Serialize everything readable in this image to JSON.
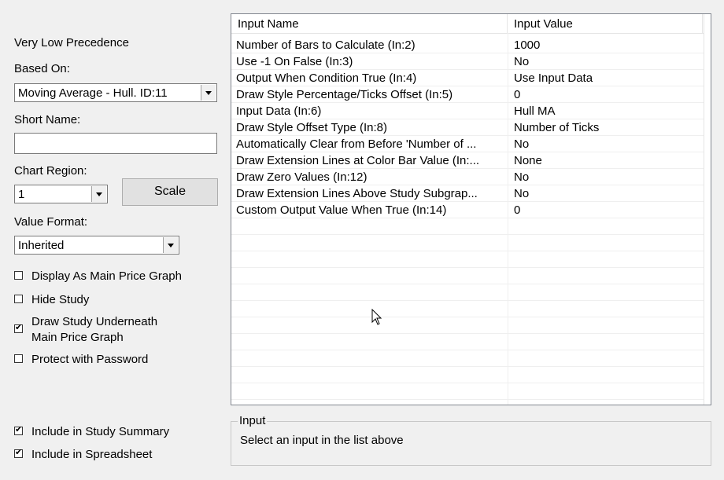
{
  "left": {
    "precedence_label": "Very Low Precedence",
    "based_on_label": "Based On:",
    "based_on_value": "Moving Average - Hull. ID:11",
    "short_name_label": "Short Name:",
    "short_name_value": "",
    "chart_region_label": "Chart Region:",
    "chart_region_value": "1",
    "scale_button": "Scale",
    "value_format_label": "Value Format:",
    "value_format_value": "Inherited",
    "checkboxes": [
      {
        "label": "Display As Main Price Graph",
        "checked": false
      },
      {
        "label": "Hide Study",
        "checked": false
      },
      {
        "label": "Draw Study Underneath",
        "label2": "Main Price Graph",
        "checked": true
      },
      {
        "label": "Protect with Password",
        "checked": false
      },
      {
        "label": "Include in Study Summary",
        "checked": true
      },
      {
        "label": "Include in Spreadsheet",
        "checked": true
      }
    ]
  },
  "grid": {
    "headers": [
      "Input Name",
      "Input Value"
    ],
    "rows": [
      {
        "name": "Number of Bars to Calculate   (In:2)",
        "value": "1000"
      },
      {
        "name": "Use -1 On False   (In:3)",
        "value": "No"
      },
      {
        "name": "Output When Condition True   (In:4)",
        "value": "Use Input Data"
      },
      {
        "name": "Draw Style Percentage/Ticks Offset   (In:5)",
        "value": "0"
      },
      {
        "name": "Input Data   (In:6)",
        "value": "Hull MA"
      },
      {
        "name": "Draw Style Offset Type   (In:8)",
        "value": "Number of Ticks"
      },
      {
        "name": "Automatically Clear from Before 'Number of ...",
        "value": "No"
      },
      {
        "name": "Draw Extension Lines at Color Bar Value   (In:...",
        "value": "None"
      },
      {
        "name": "Draw Zero Values   (In:12)",
        "value": "No"
      },
      {
        "name": "Draw Extension Lines Above Study Subgrap...",
        "value": "No"
      },
      {
        "name": "Custom Output Value When True   (In:14)",
        "value": "0"
      }
    ]
  },
  "input_group": {
    "legend": "Input",
    "text": "Select an input in the list above"
  }
}
